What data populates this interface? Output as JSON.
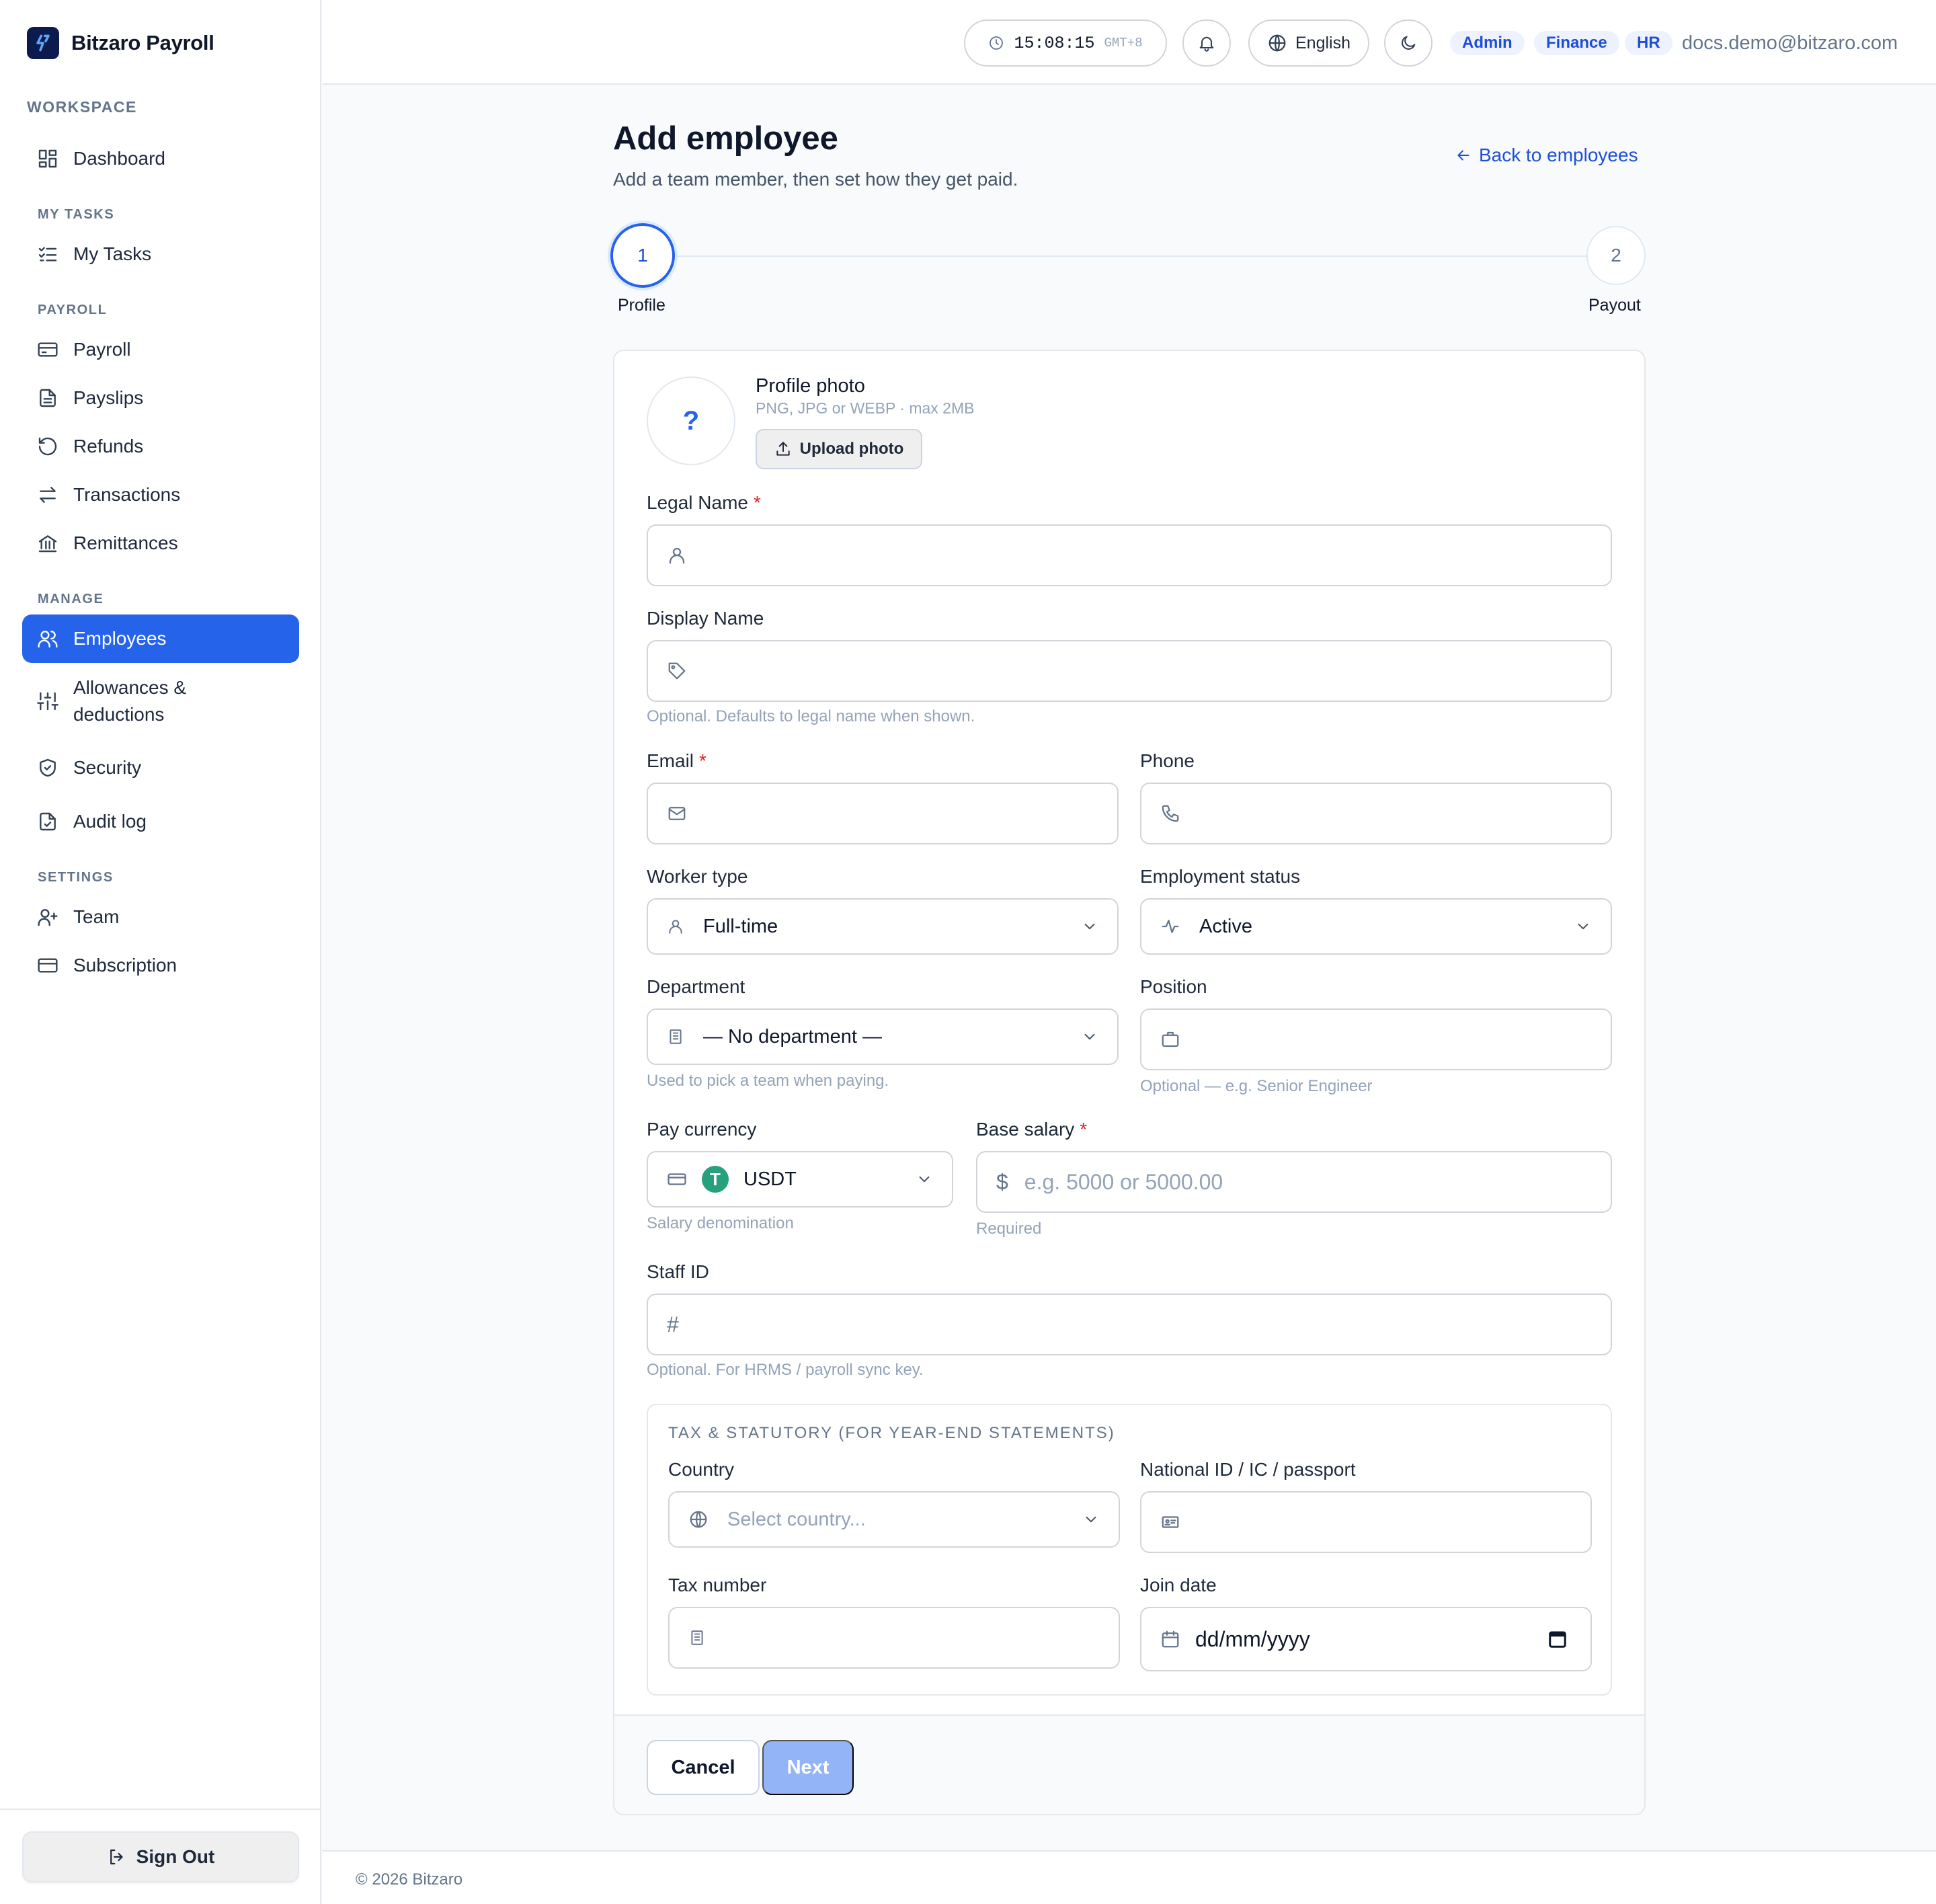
{
  "app": {
    "name": "Bitzaro Payroll"
  },
  "sidebar": {
    "workspace_label": "WORKSPACE",
    "sections": {
      "my_tasks": "MY TASKS",
      "payroll": "PAYROLL",
      "manage": "MANAGE",
      "settings": "SETTINGS"
    },
    "items": {
      "dashboard": "Dashboard",
      "my_tasks": "My Tasks",
      "payroll": "Payroll",
      "payslips": "Payslips",
      "refunds": "Refunds",
      "transactions": "Transactions",
      "remittances": "Remittances",
      "employees": "Employees",
      "allowances_1": "Allowances &",
      "allowances_2": "deductions",
      "security": "Security",
      "audit_log": "Audit log",
      "team": "Team",
      "subscription": "Subscription"
    },
    "active": "employees",
    "sign_out": "Sign Out"
  },
  "header": {
    "time": "15:08:15",
    "timezone": "GMT+8",
    "language": "English",
    "roles": [
      "Admin",
      "Finance",
      "HR"
    ],
    "user_email": "docs.demo@bitzaro.com"
  },
  "page": {
    "title": "Add employee",
    "subtitle": "Add a team member, then set how they get paid.",
    "back_link": "Back to employees",
    "steps": [
      {
        "number": "1",
        "label": "Profile"
      },
      {
        "number": "2",
        "label": "Payout"
      }
    ],
    "current_step": 1
  },
  "form": {
    "photo": {
      "placeholder": "?",
      "title": "Profile photo",
      "hint": "PNG, JPG or WEBP · max 2MB",
      "upload": "Upload photo"
    },
    "legal_name": {
      "label": "Legal Name",
      "required": "*",
      "value": ""
    },
    "display_name": {
      "label": "Display Name",
      "value": "",
      "hint": "Optional. Defaults to legal name when shown."
    },
    "email": {
      "label": "Email",
      "required": "*",
      "value": ""
    },
    "phone": {
      "label": "Phone",
      "value": ""
    },
    "worker_type": {
      "label": "Worker type",
      "value": "Full-time"
    },
    "employment_status": {
      "label": "Employment status",
      "value": "Active"
    },
    "department": {
      "label": "Department",
      "value": "— No department —",
      "hint": "Used to pick a team when paying."
    },
    "position": {
      "label": "Position",
      "value": "",
      "hint": "Optional — e.g. Senior Engineer"
    },
    "pay_currency": {
      "label": "Pay currency",
      "value": "USDT",
      "coin_symbol": "T",
      "hint": "Salary denomination"
    },
    "base_salary": {
      "label": "Base salary",
      "required": "*",
      "placeholder": "e.g. 5000 or 5000.00",
      "prefix": "$",
      "hint": "Required"
    },
    "staff_id": {
      "label": "Staff ID",
      "value": "",
      "prefix": "#",
      "hint": "Optional. For HRMS / payroll sync key."
    },
    "tax_section": {
      "title": "TAX & STATUTORY (FOR YEAR-END STATEMENTS)",
      "country": {
        "label": "Country",
        "placeholder": "Select country..."
      },
      "national_id": {
        "label": "National ID / IC / passport",
        "value": ""
      },
      "tax_number": {
        "label": "Tax number",
        "value": ""
      },
      "join_date": {
        "label": "Join date",
        "placeholder": "dd/mm/yyyy"
      }
    },
    "buttons": {
      "cancel": "Cancel",
      "next": "Next"
    }
  },
  "footer": {
    "copyright": "© 2026 Bitzaro"
  },
  "colors": {
    "accent": "#2563eb",
    "accent_disabled": "#93b4f6",
    "required": "#dc2626",
    "tether": "#26a17b"
  }
}
